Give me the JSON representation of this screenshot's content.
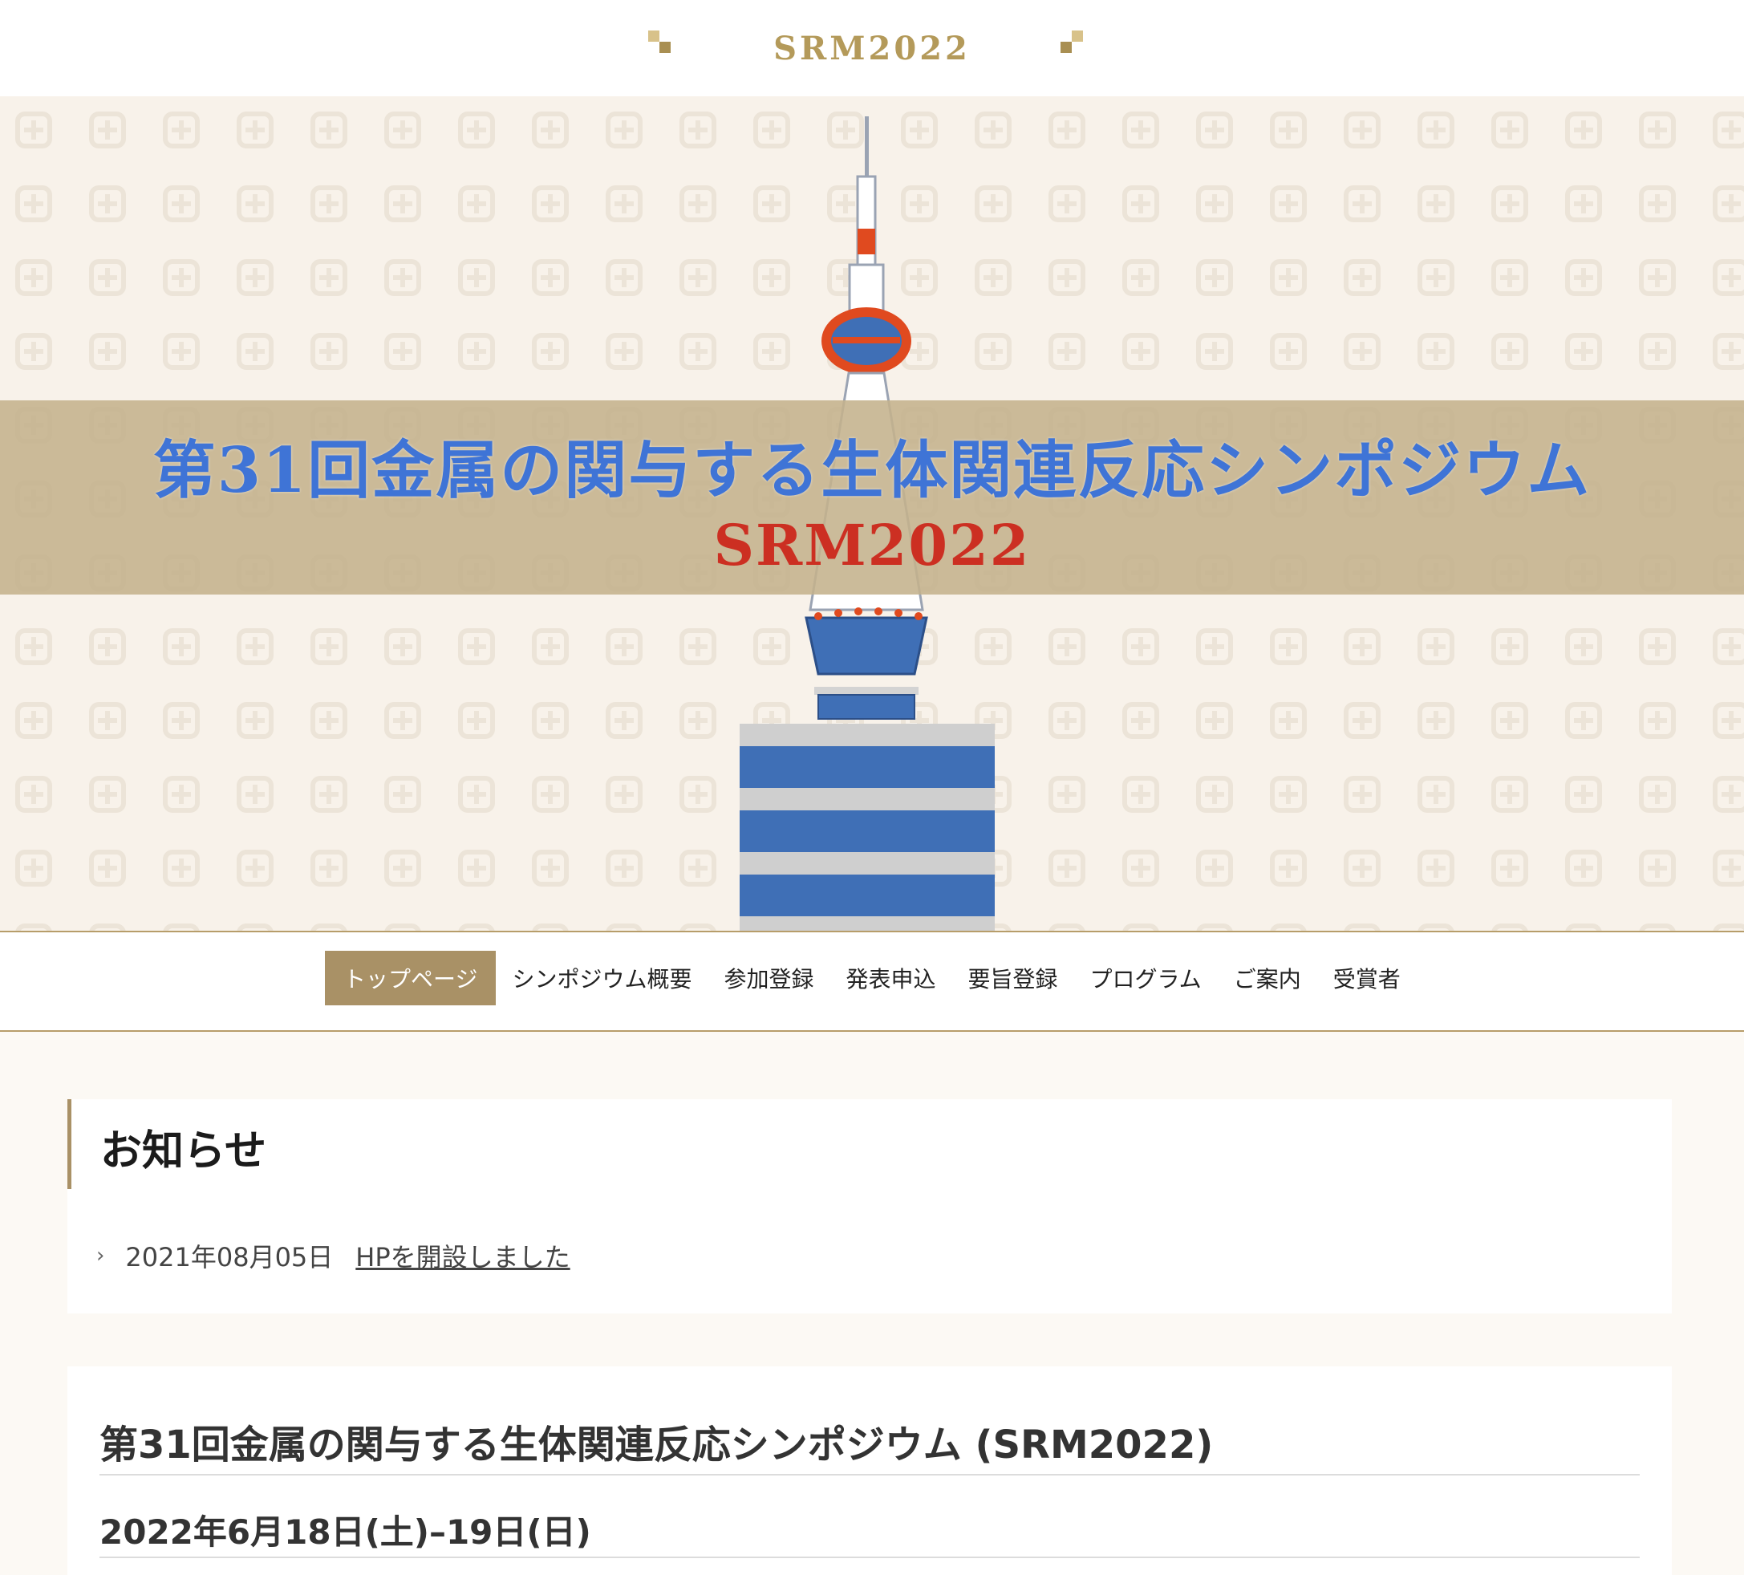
{
  "header": {
    "brand": "SRM2022",
    "accent_color": "#b49a5a"
  },
  "hero": {
    "title": "第31回金属の関与する生体関連反応シンポジウム",
    "subtitle": "SRM2022",
    "title_color": "#3f74d6",
    "subtitle_color": "#cc2f22",
    "band_color": "#c4b28c",
    "illustration": "kyoto-tower"
  },
  "nav": {
    "items": [
      {
        "label": "トップページ",
        "active": true
      },
      {
        "label": "シンポジウム概要"
      },
      {
        "label": "参加登録"
      },
      {
        "label": "発表申込"
      },
      {
        "label": "要旨登録"
      },
      {
        "label": "プログラム"
      },
      {
        "label": "ご案内"
      },
      {
        "label": "受賞者"
      }
    ],
    "active_color": "#a99166"
  },
  "news": {
    "heading": "お知らせ",
    "items": [
      {
        "date": "2021年08月05日",
        "text": "HPを開設しました"
      }
    ]
  },
  "event": {
    "title": "第31回金属の関与する生体関連反応シンポジウム (SRM2022)",
    "date": "2022年6月18日(土)–19日(日)"
  }
}
